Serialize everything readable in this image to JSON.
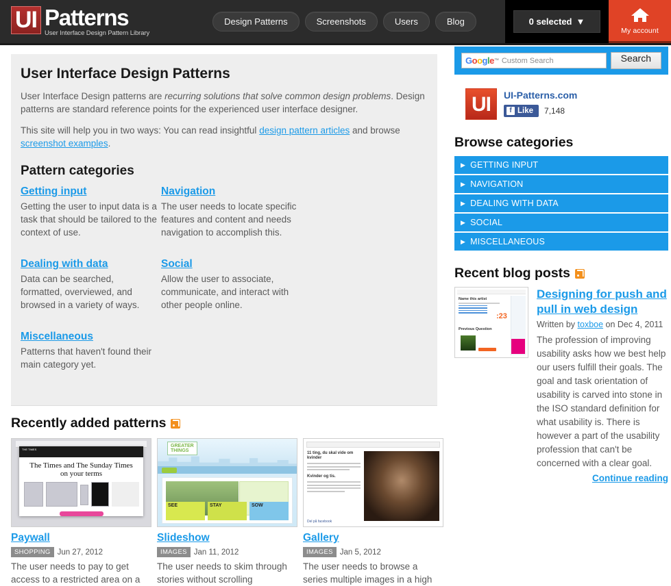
{
  "header": {
    "logo_mark": "UI",
    "logo_word": "Patterns",
    "logo_tagline": "User Interface Design Pattern Library",
    "nav": [
      {
        "label": "Design Patterns"
      },
      {
        "label": "Screenshots"
      },
      {
        "label": "Users"
      },
      {
        "label": "Blog"
      }
    ],
    "selected_label": "0 selected",
    "selected_caret": "▼",
    "account_label": "My account",
    "account_icon": "home-icon"
  },
  "intro": {
    "title": "User Interface Design Patterns",
    "para1_a": "User Interface Design patterns are ",
    "para1_em": "recurring solutions that solve common design problems",
    "para1_b": ". Design patterns are standard reference points for the experienced user interface designer.",
    "para2_a": "This site will help you in two ways: You can read insightful ",
    "para2_link1": "design pattern articles",
    "para2_b": " and browse ",
    "para2_link2": "screenshot examples",
    "para2_c": ".",
    "categories_heading": "Pattern categories",
    "categories": [
      {
        "title": "Getting input",
        "desc": "Getting the user to input data is a task that should be tailored to the context of use."
      },
      {
        "title": "Navigation",
        "desc": "The user needs to locate specific features and content and needs navigation to accomplish this."
      },
      {
        "title": "Dealing with data",
        "desc": "Data can be searched, formatted, overviewed, and browsed in a variety of ways."
      },
      {
        "title": "Social",
        "desc": "Allow the user to associate, communicate, and interact with other people online."
      },
      {
        "title": "Miscellaneous",
        "desc": "Patterns that haven't found their main category yet."
      }
    ]
  },
  "recent": {
    "heading": "Recently added patterns",
    "rss_icon": "rss-icon",
    "patterns": [
      {
        "title": "Paywall",
        "tag": "SHOPPING",
        "date": "Jun 27, 2012",
        "desc": "The user needs to pay to get access to a restricted area on a",
        "thumb_alt": "The Times and The Sunday Times on your terms"
      },
      {
        "title": "Slideshow",
        "tag": "IMAGES",
        "date": "Jan 11, 2012",
        "desc": "The user needs to skim through stories without scrolling",
        "thumb_alt": "Greater Things homepage"
      },
      {
        "title": "Gallery",
        "tag": "IMAGES",
        "date": "Jan 5, 2012",
        "desc": "The user needs to browse a series multiple images in a high",
        "thumb_alt": "11 ting, du skal vide om kvinder"
      }
    ]
  },
  "sidebar": {
    "search": {
      "google_mark": "Google",
      "tm": "™",
      "placeholder": "Custom Search",
      "button_label": "Search",
      "value": ""
    },
    "facebook": {
      "badge": "UI",
      "page_name": "UI-Patterns.com",
      "like_label": "Like",
      "f_glyph": "f",
      "count": "7,148"
    },
    "browse_heading": "Browse categories",
    "browse_items": [
      {
        "label": "GETTING INPUT"
      },
      {
        "label": "NAVIGATION"
      },
      {
        "label": "DEALING WITH DATA"
      },
      {
        "label": "SOCIAL"
      },
      {
        "label": "MISCELLANEOUS"
      }
    ],
    "blog_heading": "Recent blog posts",
    "blog_rss_icon": "rss-icon",
    "post": {
      "title": "Designing for push and pull in web design",
      "byline_prefix": "Written by ",
      "author": "toxboe",
      "byline_suffix": " on Dec 4, 2011",
      "excerpt": "The profession of improving usability asks how we best help our users fulfill their goals. The goal and task orientation of usability is carved into stone in the ISO standard definition for what usability is. There is however a part of the usability profession that can't be concerned with a clear goal.",
      "continue_label": "Continue reading"
    }
  },
  "colors": {
    "accent_blue": "#1b9ae8",
    "header_dark": "#2b2b2b",
    "account_red": "#e04326",
    "rss_orange": "#f3901d",
    "tag_grey": "#8c8c8c",
    "panel_grey": "#eeeeee"
  }
}
